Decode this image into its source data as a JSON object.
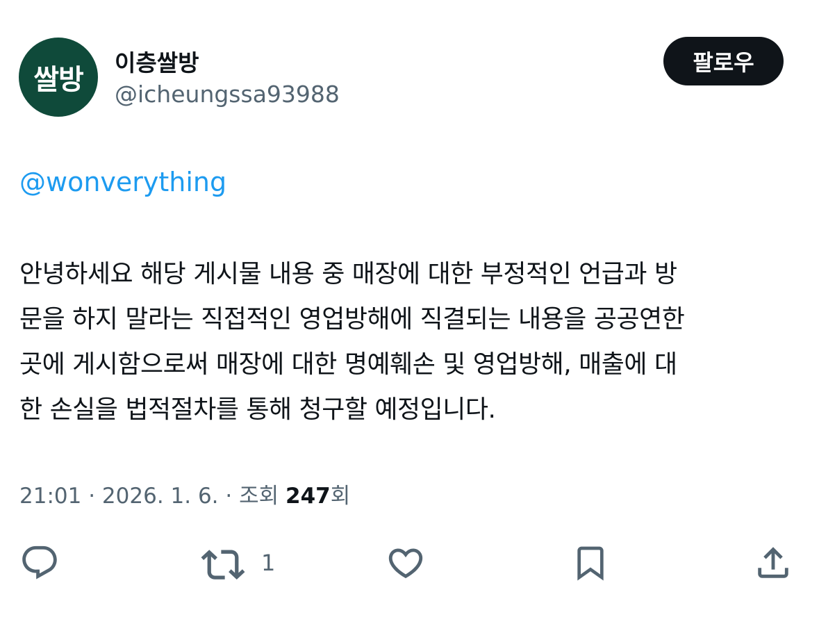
{
  "author": {
    "avatar_text": "쌀방",
    "display_name": "이층쌀방",
    "handle": "@icheungssa93988"
  },
  "follow_button": {
    "label": "팔로우"
  },
  "tweet": {
    "mention": "@wonverything",
    "lines": [
      "안녕하세요 해당 게시물 내용 중 매장에 대한 부정적인 언급과 방",
      "문을 하지 말라는 직접적인 영업방해에 직결되는 내용을 공공연한",
      "곳에 게시함으로써 매장에 대한 명예훼손 및 영업방해, 매출에 대",
      "한 손실을 법적절차를 통해 청구할 예정입니다."
    ],
    "time": "21:01",
    "date": "2026. 1. 6.",
    "views_label": "조회",
    "views_count": "247",
    "views_suffix": "회"
  },
  "actions": {
    "retweet_count": "1",
    "icons": [
      "reply-icon",
      "retweet-icon",
      "like-icon",
      "bookmark-icon",
      "share-icon"
    ]
  },
  "colors": {
    "avatar_bg": "#0f4a3a",
    "mention": "#1d9bf0",
    "secondary_text": "#536471",
    "primary_text": "#0f1419",
    "follow_bg": "#0f1419"
  }
}
